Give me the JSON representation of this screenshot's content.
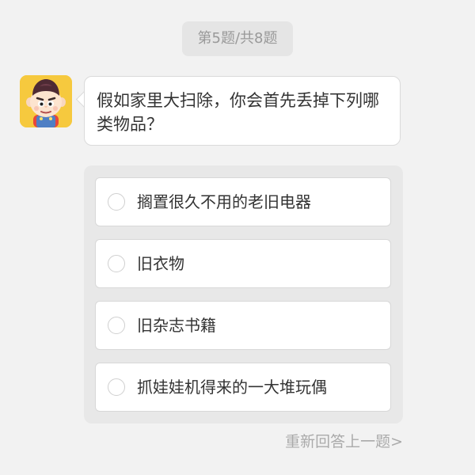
{
  "progress": {
    "label": "第5题/共8题"
  },
  "question": {
    "text": "假如家里大扫除，你会首先丢掉下列哪类物品？"
  },
  "options": [
    {
      "label": "搁置很久不用的老旧电器",
      "selected": false
    },
    {
      "label": "旧衣物",
      "selected": false
    },
    {
      "label": "旧杂志书籍",
      "selected": false
    },
    {
      "label": "抓娃娃机得来的一大堆玩偶",
      "selected": false
    }
  ],
  "redo": {
    "label": "重新回答上一题>"
  },
  "avatar": {
    "icon": "cartoon-boy-avatar",
    "background": "#f6c93e"
  },
  "colors": {
    "page_background": "#f2f2f2",
    "panel_background": "#e8e8e8",
    "card_background": "#ffffff",
    "muted_text": "#aaaaaa"
  }
}
